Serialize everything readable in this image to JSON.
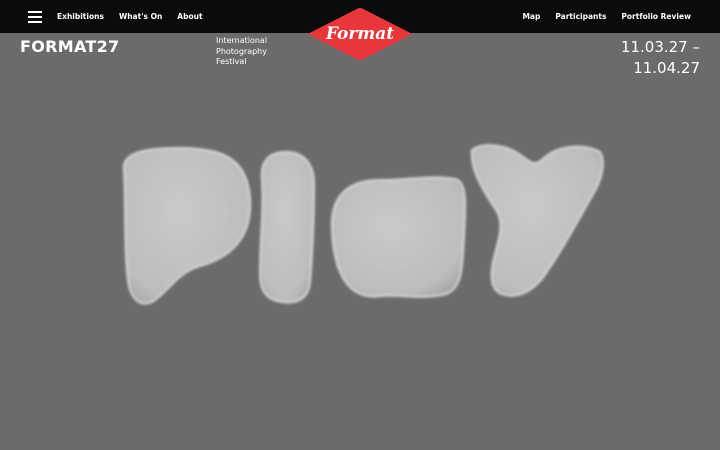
{
  "nav": {
    "left": [
      "Exhibitions",
      "What's On",
      "About"
    ],
    "right": [
      "Map",
      "Participants",
      "Portfolio Review"
    ]
  },
  "logo": {
    "text": "Format",
    "color": "#e8363b"
  },
  "festival": {
    "name": "FORMAT27",
    "tagline": [
      "International",
      "Photography",
      "Festival"
    ],
    "dates": [
      "11.03.27 –",
      "11.04.27"
    ]
  },
  "hero": {
    "word": "Play"
  },
  "colors": {
    "background": "#6b6b6b",
    "topbar": "#0b0b0b",
    "hero_letters": "#c4c4c4",
    "logo": "#e8363b"
  }
}
